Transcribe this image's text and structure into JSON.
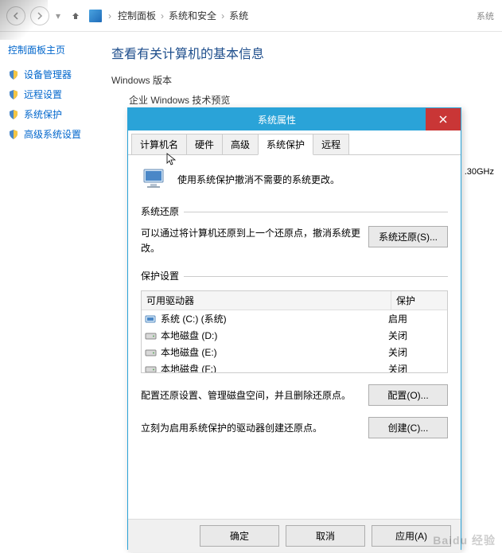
{
  "addressbar": {
    "hint": "系统"
  },
  "breadcrumb": {
    "l1": "控制面板",
    "l2": "系统和安全",
    "l3": "系统"
  },
  "sidebar": {
    "header": "控制面板主页",
    "items": [
      "设备管理器",
      "远程设置",
      "系统保护",
      "高级系统设置"
    ]
  },
  "page": {
    "title": "查看有关计算机的基本信息",
    "section1": "Windows 版本",
    "sub1": "企业 Windows 技术预览",
    "ghz": ".30GHz"
  },
  "dialog": {
    "title": "系统属性",
    "tabs": {
      "t1": "计算机名",
      "t2": "硬件",
      "t3": "高级",
      "t4": "系统保护",
      "t5": "远程"
    },
    "info": "使用系统保护撤消不需要的系统更改。",
    "restore": {
      "group": "系统还原",
      "text": "可以通过将计算机还原到上一个还原点，撤消系统更改。",
      "button": "系统还原(S)..."
    },
    "protect": {
      "group": "保护设置",
      "col1": "可用驱动器",
      "col2": "保护",
      "drives": [
        {
          "label": "系统 (C:) (系统)",
          "prot": "启用",
          "type": "sys"
        },
        {
          "label": "本地磁盘 (D:)",
          "prot": "关闭",
          "type": "hdd"
        },
        {
          "label": "本地磁盘 (E:)",
          "prot": "关闭",
          "type": "hdd"
        },
        {
          "label": "本地磁盘 (F:)",
          "prot": "关闭",
          "type": "hdd"
        }
      ],
      "cfgtext": "配置还原设置、管理磁盘空间，并且删除还原点。",
      "cfgbtn": "配置(O)...",
      "createtext": "立刻为启用系统保护的驱动器创建还原点。",
      "createbtn": "创建(C)..."
    },
    "footer": {
      "ok": "确定",
      "cancel": "取消",
      "apply": "应用(A)"
    }
  },
  "watermark": "Baidu 经验"
}
